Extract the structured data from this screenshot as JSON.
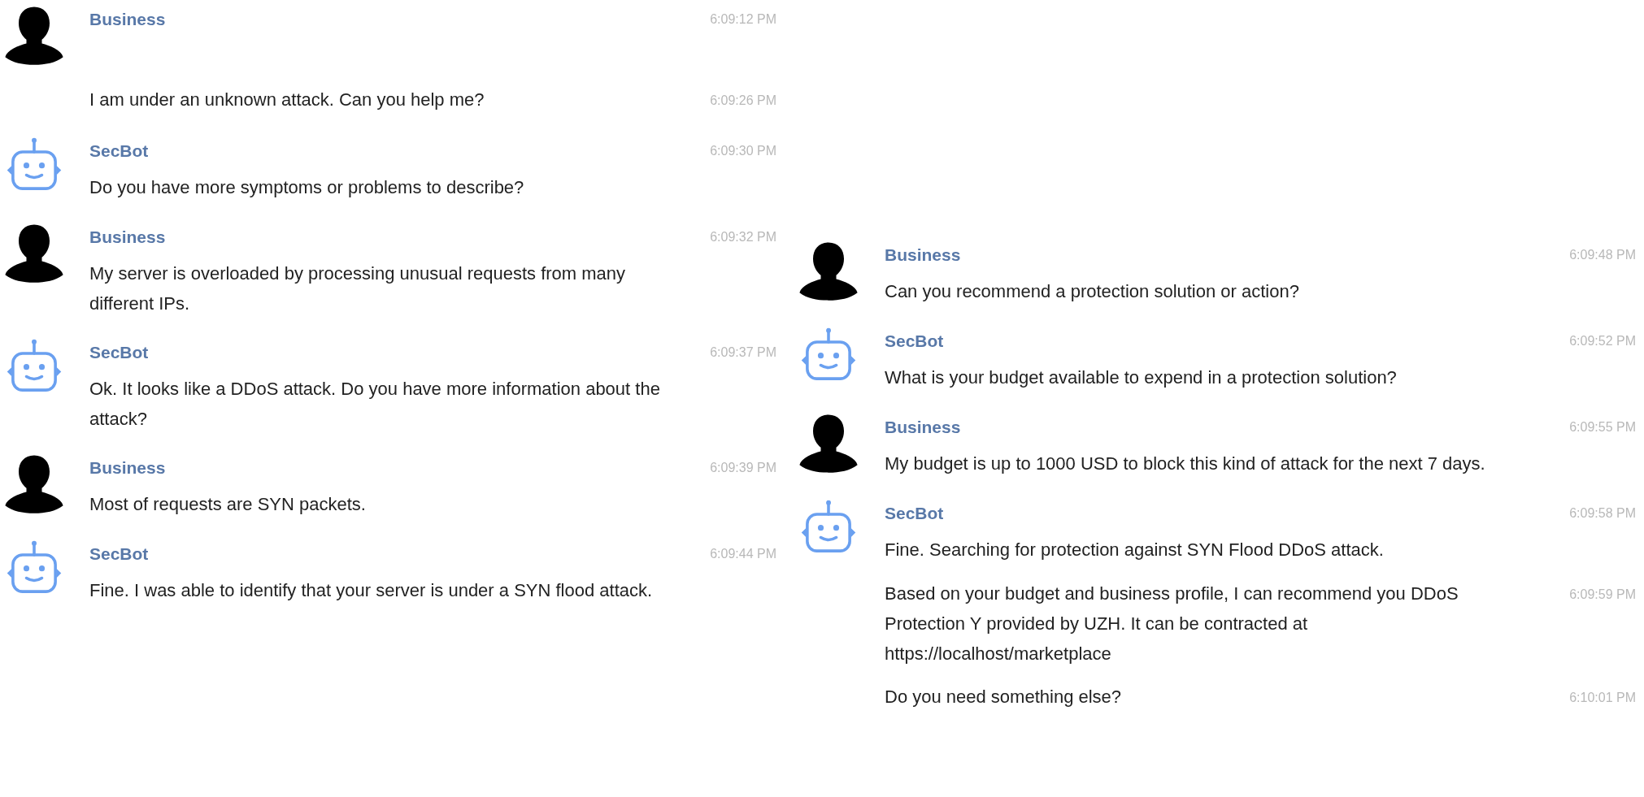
{
  "panels": [
    {
      "groups": [
        {
          "sender": "Business",
          "kind": "person",
          "time": "6:09:12 PM",
          "followups": [
            {
              "text": "I am under an unknown attack. Can you help me?",
              "time": "6:09:26 PM"
            }
          ]
        },
        {
          "sender": "SecBot",
          "kind": "bot",
          "time": "6:09:30 PM",
          "text": "Do you have more symptoms or problems to describe?"
        },
        {
          "sender": "Business",
          "kind": "person",
          "time": "6:09:32 PM",
          "text": "My server is overloaded by processing unusual requests from many different IPs."
        },
        {
          "sender": "SecBot",
          "kind": "bot",
          "time": "6:09:37 PM",
          "text": "Ok. It looks like a DDoS attack. Do you have more information about the attack?"
        },
        {
          "sender": "Business",
          "kind": "person",
          "time": "6:09:39 PM",
          "text": "Most of requests are SYN packets."
        },
        {
          "sender": "SecBot",
          "kind": "bot",
          "time": "6:09:44 PM",
          "text": "Fine. I was able to identify that your server is under a SYN flood attack."
        }
      ]
    },
    {
      "groups": [
        {
          "sender": "Business",
          "kind": "person",
          "time": "6:09:48 PM",
          "text": "Can you recommend a protection solution or action?"
        },
        {
          "sender": "SecBot",
          "kind": "bot",
          "time": "6:09:52 PM",
          "text": "What is your budget available to expend in a protection solution?"
        },
        {
          "sender": "Business",
          "kind": "person",
          "time": "6:09:55 PM",
          "text": "My budget is up to 1000 USD to block this kind of attack for the next 7 days."
        },
        {
          "sender": "SecBot",
          "kind": "bot",
          "time": "6:09:58 PM",
          "text": "Fine. Searching for protection against SYN Flood DDoS attack.",
          "followups": [
            {
              "text": "Based on your budget and business profile, I can recommend you DDoS Protection Y provided by UZH. It can be contracted at https://localhost/marketplace",
              "time": "6:09:59 PM"
            },
            {
              "text": "Do you need something else?",
              "time": "6:10:01 PM"
            }
          ]
        }
      ]
    }
  ]
}
